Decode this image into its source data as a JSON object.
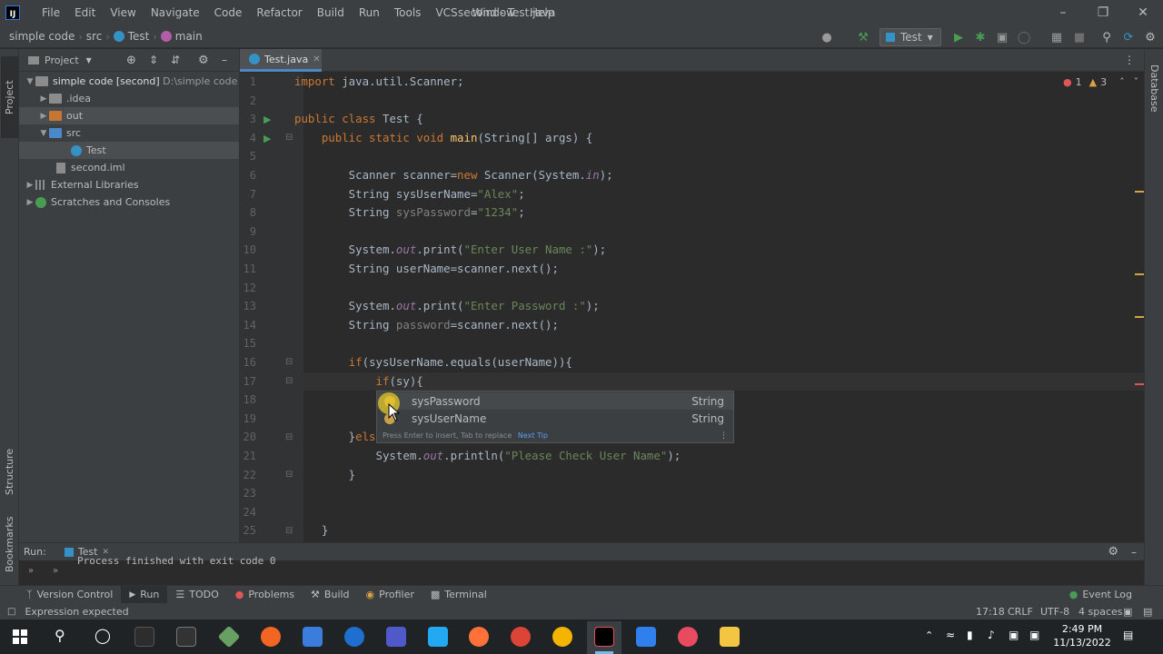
{
  "titlebar": {
    "menu": [
      "File",
      "Edit",
      "View",
      "Navigate",
      "Code",
      "Refactor",
      "Build",
      "Run",
      "Tools",
      "VCS",
      "Window",
      "Help"
    ],
    "title": "second - Test.java"
  },
  "breadcrumb": {
    "project": "simple code",
    "folder": "src",
    "class": "Test",
    "method": "main"
  },
  "run_config": "Test",
  "project_panel": {
    "title": "Project",
    "tree": {
      "root": "simple code",
      "root_module": "[second]",
      "root_path": "D:\\simple code",
      "idea": ".idea",
      "out": "out",
      "src": "src",
      "test": "Test",
      "iml": "second.iml",
      "ext_libs": "External Libraries",
      "scratches": "Scratches and Consoles"
    }
  },
  "editor": {
    "tab": "Test.java",
    "inspection": {
      "errors": "1",
      "warnings": "3"
    }
  },
  "completion": {
    "items": [
      {
        "name": "sysPassword",
        "type": "String"
      },
      {
        "name": "sysUserName",
        "type": "String"
      }
    ],
    "hint": "Press Enter to insert, Tab to replace",
    "next_tip": "Next Tip"
  },
  "left_stripe": {
    "project": "Project",
    "structure": "Structure",
    "bookmarks": "Bookmarks"
  },
  "right_stripe": {
    "database": "Database"
  },
  "run_panel": {
    "label": "Run:",
    "tab": "Test",
    "output": "Process finished with exit code 0"
  },
  "tool_windows": [
    "Version Control",
    "Run",
    "TODO",
    "Problems",
    "Build",
    "Profiler",
    "Terminal"
  ],
  "event_log": "Event Log",
  "status": {
    "message": "Expression expected",
    "position": "17:18",
    "line_sep": "CRLF",
    "encoding": "UTF-8",
    "indent": "4 spaces"
  },
  "taskbar": {
    "time": "2:49 PM",
    "date": "11/13/2022"
  }
}
